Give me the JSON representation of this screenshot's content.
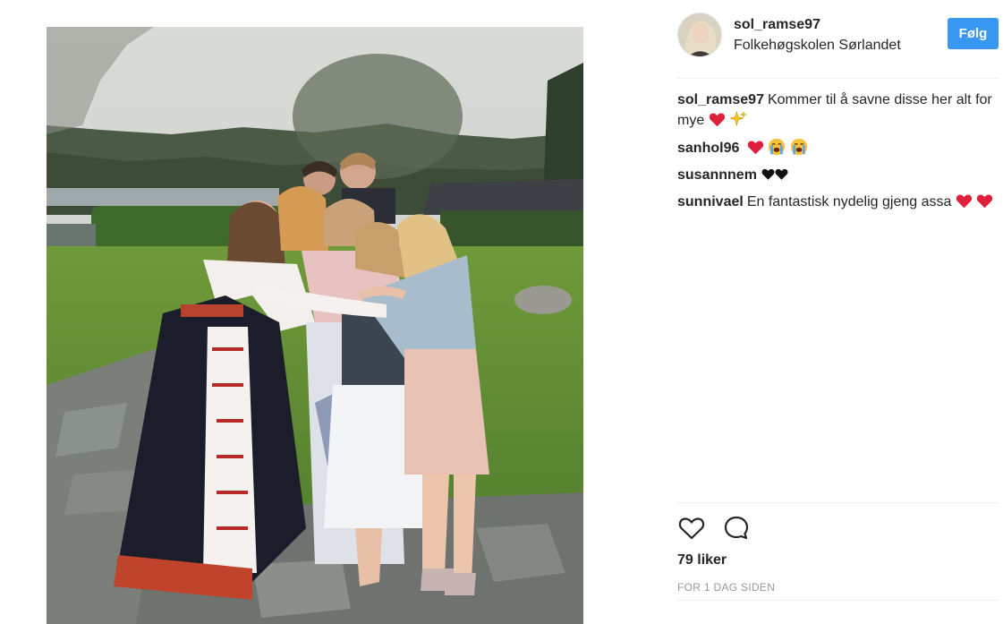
{
  "post": {
    "username": "sol_ramse97",
    "location": "Folkehøgskolen Sørlandet",
    "follow_label": "Følg",
    "caption_author": "sol_ramse97",
    "caption_text": "Kommer til å savne disse her alt for mye",
    "comments": [
      {
        "author": "sanhol96",
        "text": ""
      },
      {
        "author": "susannnem",
        "text": ""
      },
      {
        "author": "sunnivael",
        "text": "En fantastisk nydelig gjeng assa"
      }
    ],
    "likes": "79 liker",
    "timestamp": "FOR 1 DAG SIDEN"
  },
  "icons": {
    "like": "heart-outline-icon",
    "comment": "comment-bubble-icon"
  },
  "colors": {
    "follow_button": "#3897f0",
    "heart_red": "#e0203a",
    "text": "#262626",
    "muted": "#999999"
  }
}
